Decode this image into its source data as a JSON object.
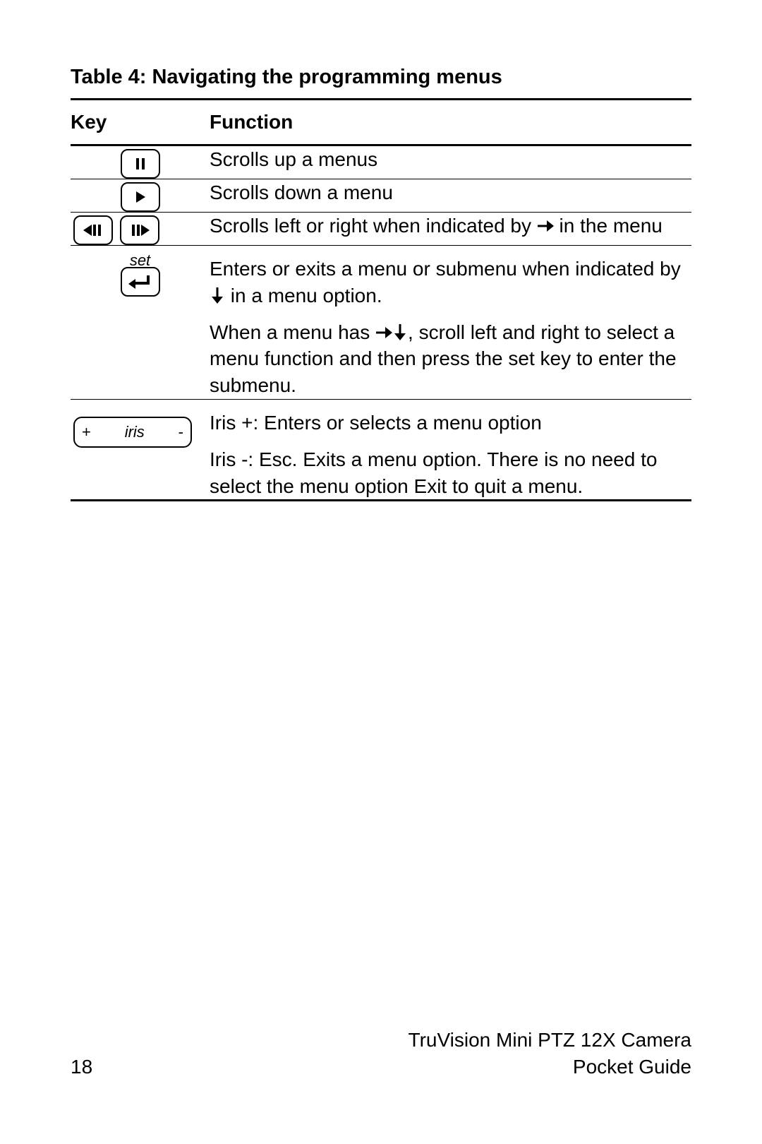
{
  "title": "Table 4: Navigating the programming menus",
  "headers": {
    "key": "Key",
    "function": "Function"
  },
  "rows": {
    "r1": {
      "func": "Scrolls up a menus",
      "icon": "pause"
    },
    "r2": {
      "func": "Scrolls down a menu",
      "icon": "play"
    },
    "r3": {
      "func_pre": "Scrolls left or right when indicated by ",
      "func_post": " in the menu",
      "icon": "left-right"
    },
    "r4": {
      "label": "set",
      "p1_pre": "Enters or exits a menu or submenu when indicated by ",
      "p1_post": " in a menu option.",
      "p2_pre": "When a menu has ",
      "p2_post": ", scroll left and right to select a menu function and then press the set key to enter the submenu.",
      "icon": "enter"
    },
    "r5": {
      "label": "iris",
      "plus": "+",
      "minus": "-",
      "p1": "Iris +: Enters or selects a menu option",
      "p2": "Iris -: Esc. Exits a menu option. There is no need to select the menu option Exit to quit a menu."
    }
  },
  "footer": {
    "page": "18",
    "line1": "TruVision Mini PTZ 12X Camera",
    "line2": "Pocket Guide"
  }
}
